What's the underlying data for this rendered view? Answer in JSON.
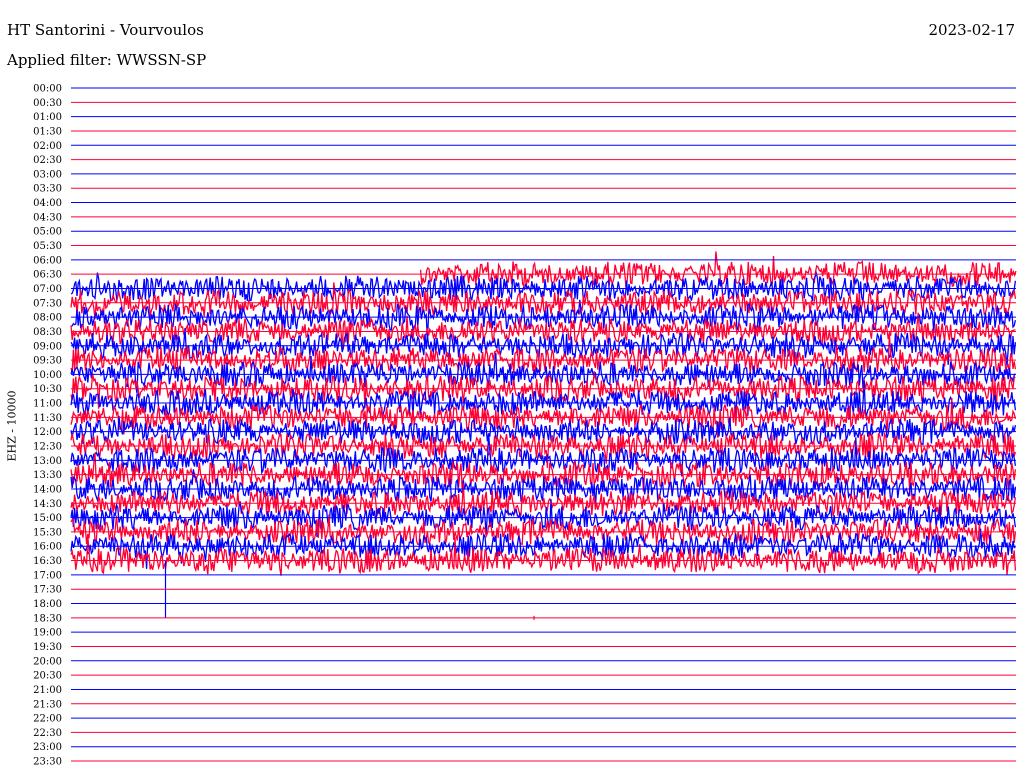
{
  "header": {
    "title": "HT Santorini - Vourvoulos",
    "date": "2023-02-17",
    "filter": "Applied filter: WWSSN-SP"
  },
  "chart_data": {
    "type": "line",
    "title": "HT Santorini - Vourvoulos",
    "subtitle": "Applied filter: WWSSN-SP",
    "ylabel": "EHZ - 10000",
    "xlabel": "",
    "row_labels": [
      "00:00",
      "00:30",
      "01:00",
      "01:30",
      "02:00",
      "02:30",
      "03:00",
      "03:30",
      "04:00",
      "04:30",
      "05:00",
      "05:30",
      "06:00",
      "06:30",
      "07:00",
      "07:30",
      "08:00",
      "08:30",
      "09:00",
      "09:30",
      "10:00",
      "10:30",
      "11:00",
      "11:30",
      "12:00",
      "12:30",
      "13:00",
      "13:30",
      "14:00",
      "14:30",
      "15:00",
      "15:30",
      "16:00",
      "16:30",
      "17:00",
      "17:30",
      "18:00",
      "18:30",
      "19:00",
      "19:30",
      "20:00",
      "20:30",
      "21:00",
      "21:30",
      "22:00",
      "22:30",
      "23:00",
      "23:30"
    ],
    "row_minutes": 30,
    "colors": [
      "#0000ff",
      "#ff0033"
    ],
    "active_rows": {
      "first": "06:30",
      "last": "16:30",
      "level": "high noise, saturated",
      "first_row_start_fraction": 0.37
    },
    "events": [
      {
        "row": "16:30",
        "description": "spike",
        "minute_fraction": 0.1
      },
      {
        "row": "18:30",
        "description": "small mark",
        "minute_fraction": 0.49
      }
    ],
    "grid": true
  }
}
